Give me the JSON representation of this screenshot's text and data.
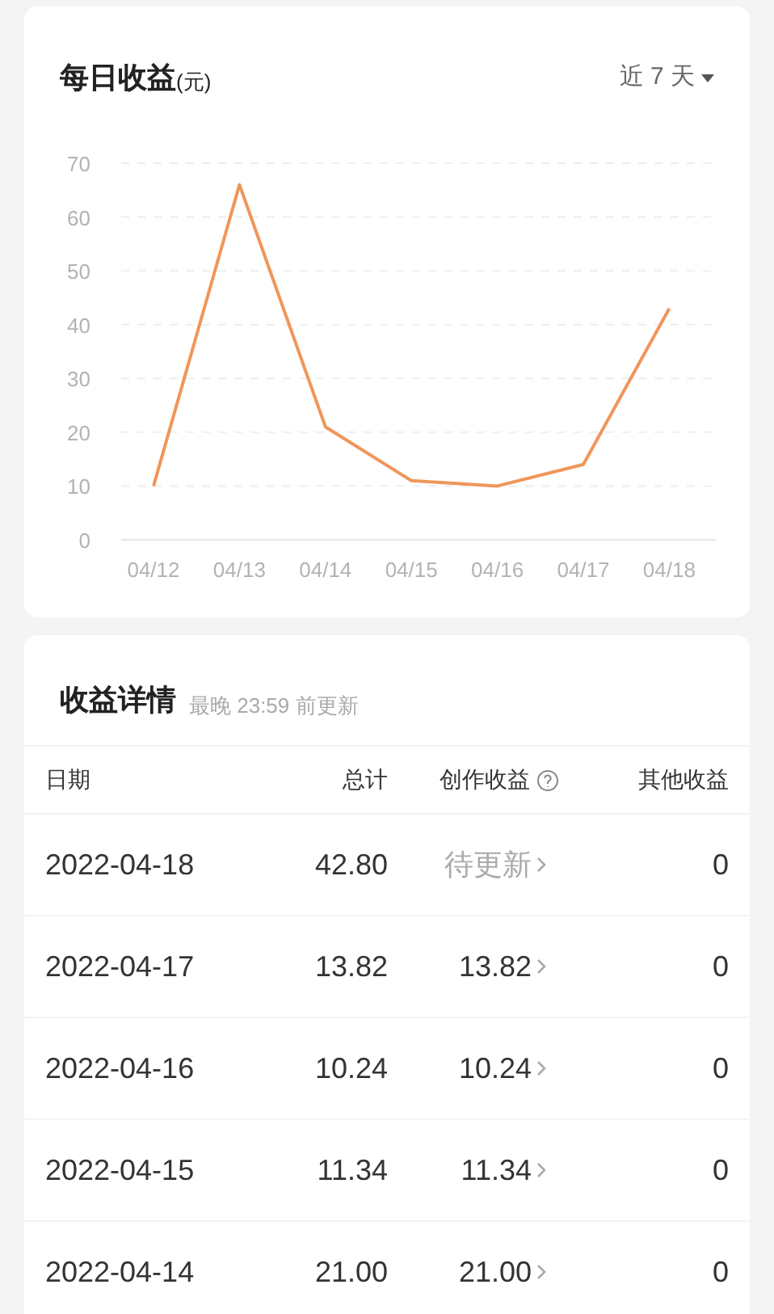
{
  "chart_card": {
    "title": "每日收益",
    "unit": "(元)",
    "range_selector": "近 7 天",
    "chart_data": {
      "type": "line",
      "categories": [
        "04/12",
        "04/13",
        "04/14",
        "04/15",
        "04/16",
        "04/17",
        "04/18"
      ],
      "ylim": [
        0,
        70
      ],
      "yticks": [
        0,
        10,
        20,
        30,
        40,
        50,
        60,
        70
      ],
      "grid": true,
      "series": [
        {
          "color": "#f0965a",
          "values": [
            10,
            66,
            21,
            11,
            10,
            14,
            43
          ]
        }
      ]
    }
  },
  "details_card": {
    "title": "收益详情",
    "note": "最晚 23:59 前更新",
    "columns": [
      "日期",
      "总计",
      "创作收益",
      "其他收益"
    ],
    "rows": [
      {
        "date": "2022-04-18",
        "total": "42.80",
        "creation": "待更新",
        "pending": true,
        "other": "0"
      },
      {
        "date": "2022-04-17",
        "total": "13.82",
        "creation": "13.82",
        "pending": false,
        "other": "0"
      },
      {
        "date": "2022-04-16",
        "total": "10.24",
        "creation": "10.24",
        "pending": false,
        "other": "0"
      },
      {
        "date": "2022-04-15",
        "total": "11.34",
        "creation": "11.34",
        "pending": false,
        "other": "0"
      },
      {
        "date": "2022-04-14",
        "total": "21.00",
        "creation": "21.00",
        "pending": false,
        "other": "0"
      }
    ]
  }
}
